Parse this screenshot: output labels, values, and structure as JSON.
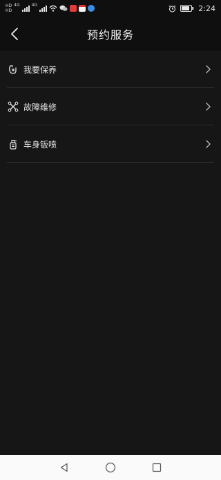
{
  "status_bar": {
    "time": "2:24",
    "hd_label": "HD",
    "network_label": "4G",
    "icons": [
      "signal-icon",
      "wifi-icon",
      "wechat-icon",
      "weibo-icon",
      "calendar-icon",
      "browser-icon",
      "alarm-icon",
      "battery-icon"
    ]
  },
  "header": {
    "title": "预约服务",
    "back_icon": "back-arrow-icon"
  },
  "menu": {
    "items": [
      {
        "label": "我要保养",
        "icon": "maintenance-icon"
      },
      {
        "label": "故障维修",
        "icon": "repair-tools-icon"
      },
      {
        "label": "车身钣喷",
        "icon": "spray-bottle-icon"
      }
    ]
  },
  "system_nav": {
    "icons": [
      "nav-back-icon",
      "nav-home-icon",
      "nav-recents-icon"
    ]
  },
  "colors": {
    "background": "#161616",
    "header_bg": "#0f0f0f",
    "text": "#e6e6e6",
    "divider": "#2a2a2a",
    "system_nav_bg": "#fafafa"
  }
}
